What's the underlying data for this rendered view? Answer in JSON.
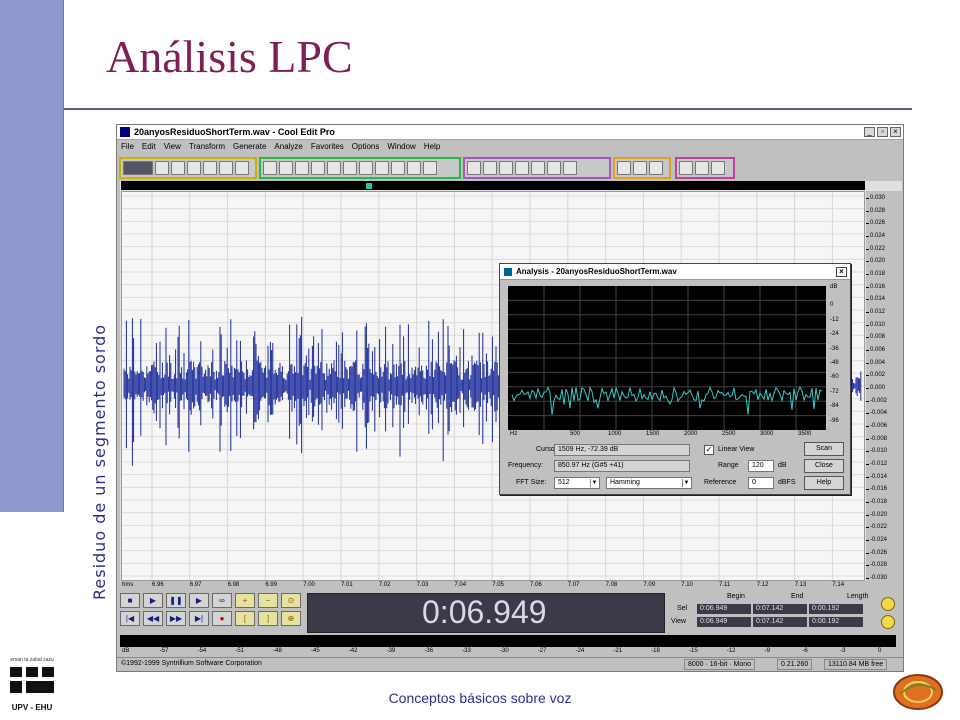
{
  "slide": {
    "title": "Análisis LPC",
    "vertical_label": "Residuo de un segmento sordo",
    "footer": "Conceptos básicos sobre voz",
    "logo_left_text": "UPV - EHU",
    "logo_left_small": "eman ta zabal zazu"
  },
  "app": {
    "title": "20anyosResiduoShortTerm.wav - Cool Edit Pro",
    "menu": [
      "File",
      "Edit",
      "View",
      "Transform",
      "Generate",
      "Analyze",
      "Favorites",
      "Options",
      "Window",
      "Help"
    ],
    "time_ruler": {
      "unit": "hms",
      "ticks": [
        "6.96",
        "6.97",
        "6.98",
        "6.99",
        "7.00",
        "7.01",
        "7.02",
        "7.03",
        "7.04",
        "7.05",
        "7.06",
        "7.07",
        "7.08",
        "7.09",
        "7.10",
        "7.11",
        "7.12",
        "7.13",
        "7.14"
      ]
    },
    "amplitude_scale": [
      "0.030",
      "0.028",
      "0.026",
      "0.024",
      "0.022",
      "0.020",
      "0.018",
      "0.016",
      "0.014",
      "0.012",
      "0.010",
      "0.008",
      "0.006",
      "0.004",
      "0.002",
      "0.000",
      "-0.002",
      "-0.004",
      "-0.006",
      "-0.008",
      "-0.010",
      "-0.012",
      "-0.014",
      "-0.016",
      "-0.018",
      "-0.020",
      "-0.022",
      "-0.024",
      "-0.026",
      "-0.028",
      "-0.030"
    ],
    "time_display": "0:06.949",
    "selection": {
      "headers": [
        "Begin",
        "End",
        "Length"
      ],
      "rows": [
        {
          "label": "Sel",
          "begin": "0:06.949",
          "end": "0:07.142",
          "length": "0:00.192"
        },
        {
          "label": "View",
          "begin": "0:06.949",
          "end": "0:07.142",
          "length": "0:00.192"
        }
      ]
    },
    "level_scale": [
      "dB",
      "-57",
      "-54",
      "-51",
      "-48",
      "-45",
      "-42",
      "-39",
      "-36",
      "-33",
      "-30",
      "-27",
      "-24",
      "-21",
      "-18",
      "-15",
      "-12",
      "-9",
      "-6",
      "-3",
      "0"
    ],
    "status": {
      "copyright": "©1992-1999 Syntrillium Software Corporation",
      "format": "8000 · 16-bit · Mono",
      "size": "0.21.260",
      "free": "13110.84 MB free"
    },
    "colors": {
      "waveform": "#1a2a9a",
      "spectrum": "#3cc8c8"
    }
  },
  "analysis": {
    "title": "Analysis - 20anyosResiduoShortTerm.wav",
    "db_scale": [
      "dB",
      "0",
      "-12",
      "-24",
      "-36",
      "-48",
      "-60",
      "-72",
      "-84",
      "-96"
    ],
    "hz_scale": [
      "Hz",
      "500",
      "1000",
      "1500",
      "2000",
      "2500",
      "3000",
      "3500"
    ],
    "cursor_label": "Cursor:",
    "cursor_value": "1509 Hz, -72.39 dB",
    "frequency_label": "Frequency:",
    "frequency_value": "850.97 Hz (G#5 +41)",
    "fft_label": "FFT Size:",
    "fft_value": "512",
    "window_value": "Hamming",
    "linear_view_label": "Linear View",
    "range_label": "Range",
    "range_value": "120",
    "range_unit": "dB",
    "reference_label": "Reference",
    "reference_value": "0",
    "reference_unit": "dBFS",
    "buttons": [
      "Scan",
      "Close",
      "Help"
    ]
  }
}
